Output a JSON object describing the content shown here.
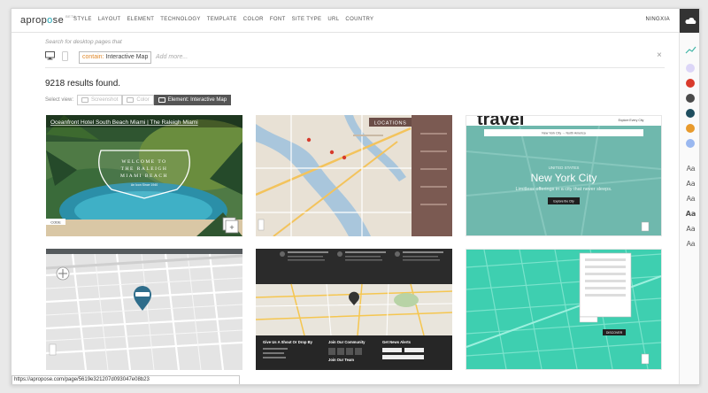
{
  "app": {
    "logo_prefix": "aprop",
    "logo_highlight": "o",
    "logo_suffix": "se",
    "logo_badge": "BETA"
  },
  "nav": [
    "STYLE",
    "LAYOUT",
    "ELEMENT",
    "TECHNOLOGY",
    "TEMPLATE",
    "COLOR",
    "FONT",
    "SITE TYPE",
    "URL",
    "COUNTRY"
  ],
  "region": "NINGXIA",
  "search": {
    "hint": "Search for desktop pages that",
    "tag_key": "contain:",
    "tag_value": "Interactive Map",
    "add_placeholder": "Add more...",
    "close_symbol": "×"
  },
  "results": {
    "count_text": "9218 results found."
  },
  "view": {
    "label": "Select view:",
    "screenshot": "Screenshot",
    "color": "Color",
    "element": "Element: Interactive Map"
  },
  "palette": [
    "#dcd6f7",
    "#d93a2b",
    "#4a4a4a",
    "#1f4e5f",
    "#e89a2c",
    "#9ab8f0"
  ],
  "font_samples": [
    "Aa",
    "Aa",
    "Aa",
    "Aa",
    "Aa",
    "Aa"
  ],
  "cards": {
    "c1": {
      "site": "Oceanfront Hotel South Beach Miami | The Raleigh Miami",
      "line1": "WELCOME TO",
      "line2": "THE RALEIGH",
      "line3": "MIAMI BEACH",
      "tagline": "An Icon Since 1940",
      "code_badge": "CODE",
      "add_symbol": "+"
    },
    "c2": {
      "label": "LOCATIONS"
    },
    "c3": {
      "brand": "travel",
      "explore_top": "Explore Every City",
      "breadcrumb": "New York City → North America",
      "country": "UNITED STATES",
      "city": "New York City",
      "subtitle": "Limitless offerings in a city that never sleeps.",
      "button": "Explore the City"
    },
    "c5": {
      "footer1": "Give Us A Shout Or Drop By",
      "footer2": "Join Our Community",
      "footer3": "Get News Alerts",
      "footer4": "Join Our Team"
    },
    "c6": {
      "button": "DISCOVER"
    }
  },
  "status_url": "https://apropose.com/page/5619e321207d093047e08b23"
}
